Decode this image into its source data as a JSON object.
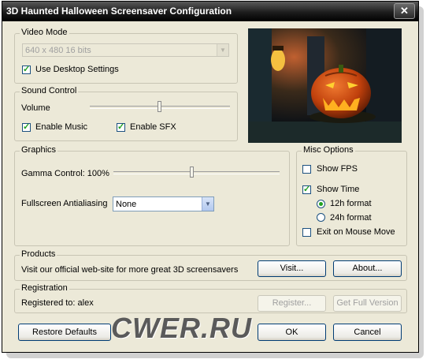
{
  "window": {
    "title": "3D Haunted Halloween Screensaver Configuration"
  },
  "video_mode": {
    "legend": "Video Mode",
    "resolution_value": "640 x 480 16 bits",
    "use_desktop_label": "Use Desktop Settings",
    "use_desktop_checked": true
  },
  "sound": {
    "legend": "Sound Control",
    "volume_label": "Volume",
    "volume_level": 0.45,
    "enable_music_label": "Enable Music",
    "enable_music_checked": true,
    "enable_sfx_label": "Enable SFX",
    "enable_sfx_checked": true
  },
  "graphics": {
    "legend": "Graphics",
    "gamma_label": "Gamma Control: 100%",
    "gamma_level": 0.48,
    "aa_label": "Fullscreen Antialiasing",
    "aa_value": "None"
  },
  "misc": {
    "legend": "Misc Options",
    "show_fps_label": "Show FPS",
    "show_fps_checked": false,
    "show_time_label": "Show Time",
    "show_time_checked": true,
    "format_12h_label": "12h format",
    "format_24h_label": "24h format",
    "selected_format": "12h",
    "exit_mouse_label": "Exit on Mouse Move",
    "exit_mouse_checked": false
  },
  "products": {
    "legend": "Products",
    "text": "Visit our official web-site for more great 3D screensavers",
    "visit_label": "Visit...",
    "about_label": "About..."
  },
  "registration": {
    "legend": "Registration",
    "text": "Registered to: alex",
    "register_label": "Register...",
    "full_version_label": "Get Full Version"
  },
  "footer": {
    "restore_label": "Restore Defaults",
    "ok_label": "OK",
    "cancel_label": "Cancel"
  },
  "watermark": {
    "text": "CWER.RU"
  }
}
